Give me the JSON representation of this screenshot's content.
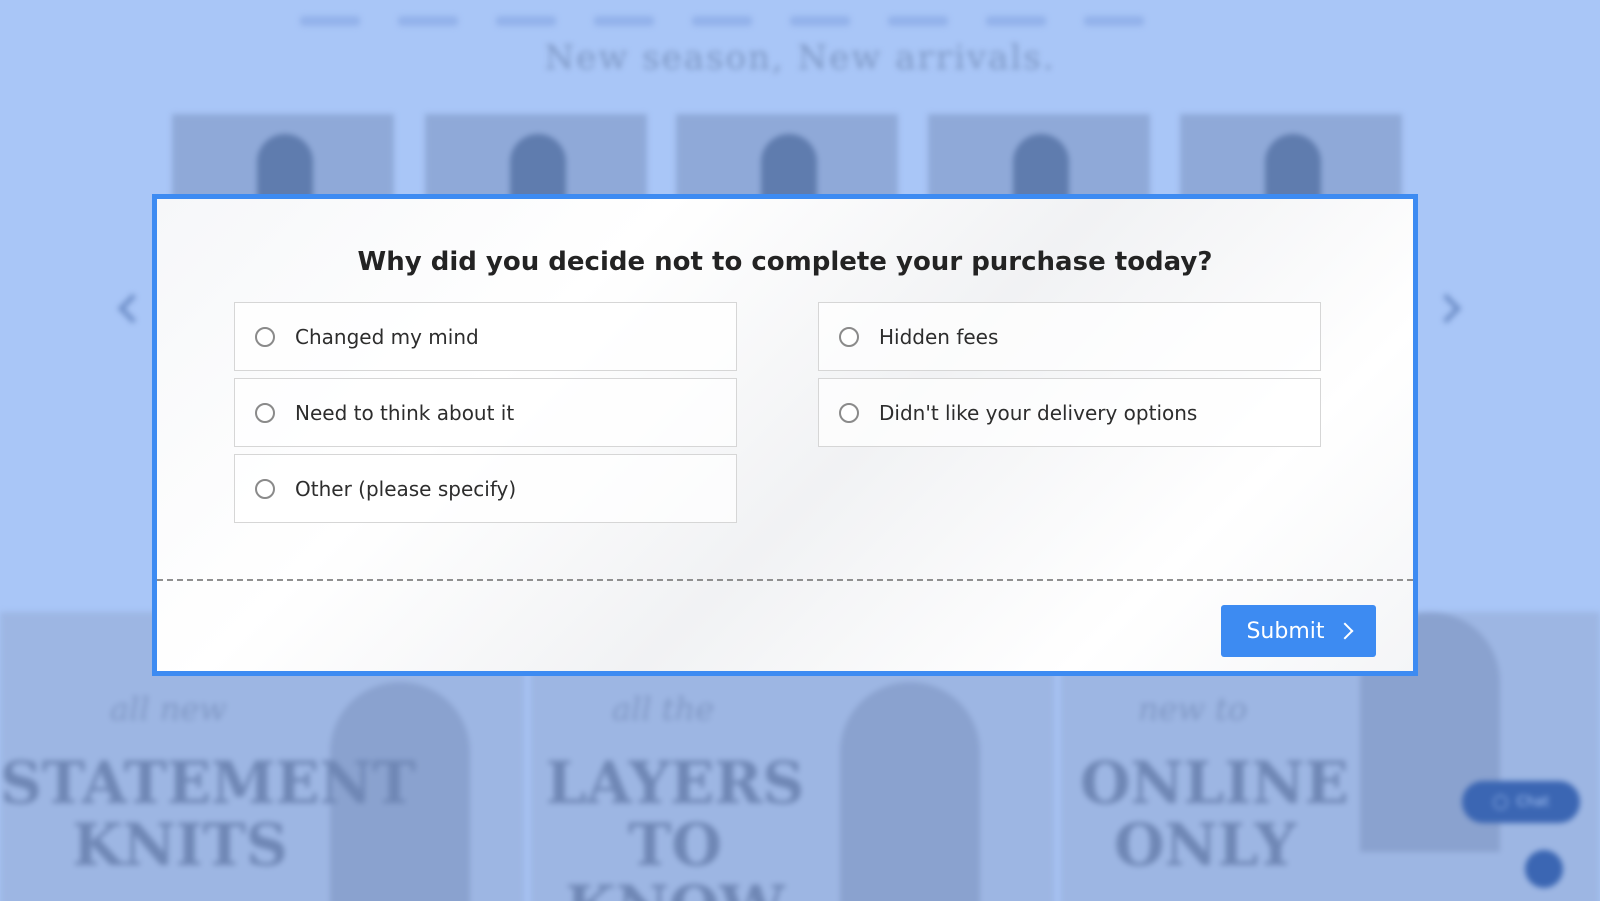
{
  "background": {
    "headline": "New season, New arrivals.",
    "banners": [
      {
        "script": "all new",
        "big": "STATEMENT KNITS"
      },
      {
        "script": "all the",
        "big": "LAYERS TO KNOW"
      },
      {
        "script": "new to",
        "big": "ONLINE ONLY"
      }
    ],
    "chat_label": "Chat"
  },
  "survey": {
    "question": "Why did you decide not to complete your purchase today?",
    "options": [
      "Changed my mind",
      "Hidden fees",
      "Need to think about it",
      "Didn't like your delivery options",
      "Other (please specify)"
    ],
    "submit_label": "Submit"
  },
  "colors": {
    "accent": "#3d8bf2",
    "backdrop": "#a9c6f7"
  }
}
